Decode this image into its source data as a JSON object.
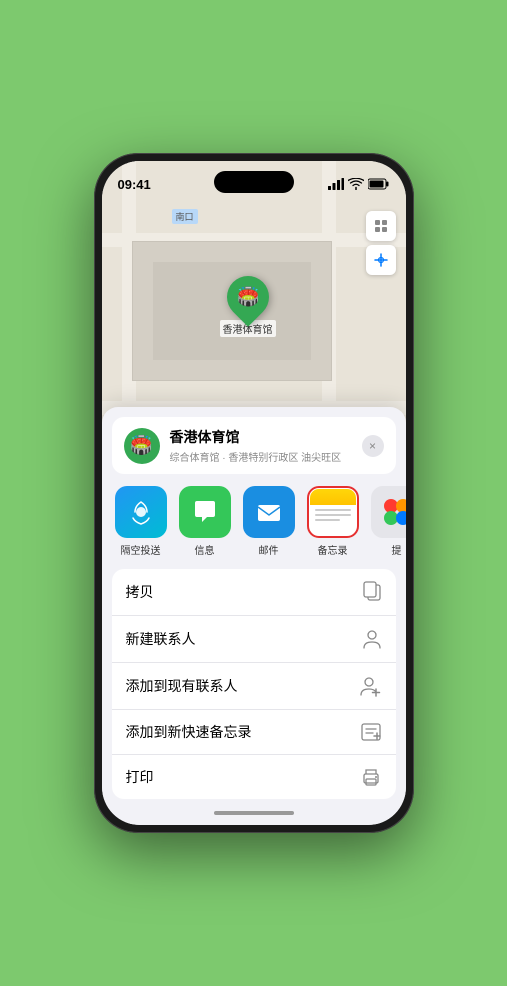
{
  "phone": {
    "status_bar": {
      "time": "09:41",
      "signal": "▌▌▌",
      "wifi": "WiFi",
      "battery": "Battery"
    },
    "map": {
      "label": "南口",
      "pin_name": "香港体育馆",
      "controls": [
        "map-icon",
        "location-icon"
      ]
    },
    "location_card": {
      "name": "香港体育馆",
      "subtitle": "综合体育馆 · 香港特别行政区 油尖旺区",
      "close_label": "×"
    },
    "share_apps": [
      {
        "id": "airdrop",
        "label": "隔空投送",
        "type": "airdrop"
      },
      {
        "id": "messages",
        "label": "信息",
        "type": "messages"
      },
      {
        "id": "mail",
        "label": "邮件",
        "type": "mail"
      },
      {
        "id": "notes",
        "label": "备忘录",
        "type": "notes"
      },
      {
        "id": "more",
        "label": "提",
        "type": "more"
      }
    ],
    "actions": [
      {
        "id": "copy",
        "label": "拷贝",
        "icon": "📋"
      },
      {
        "id": "new-contact",
        "label": "新建联系人",
        "icon": "👤"
      },
      {
        "id": "add-contact",
        "label": "添加到现有联系人",
        "icon": "👤"
      },
      {
        "id": "add-notes",
        "label": "添加到新快速备忘录",
        "icon": "📝"
      },
      {
        "id": "print",
        "label": "打印",
        "icon": "🖨️"
      }
    ]
  }
}
